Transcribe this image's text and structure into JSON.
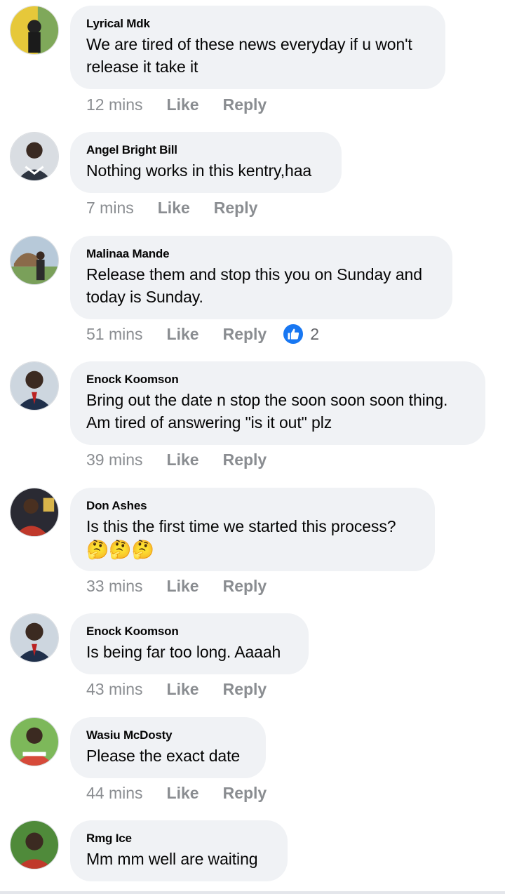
{
  "comments": [
    {
      "author": "Lyrical Mdk",
      "text": "We are tired of these news everyday if u won't release it take it",
      "time": "12 mins",
      "like": "Like",
      "reply": "Reply"
    },
    {
      "author": "Angel Bright Bill",
      "text": "Nothing works in this kentry,haa",
      "time": "7 mins",
      "like": "Like",
      "reply": "Reply"
    },
    {
      "author": "Malinaa Mande",
      "text": "Release them and stop this you on Sunday and today is Sunday.",
      "time": "51 mins",
      "like": "Like",
      "reply": "Reply",
      "reaction_count": "2"
    },
    {
      "author": "Enock Koomson",
      "text": "Bring out the date n stop the soon soon soon thing. Am tired of answering \"is it out\" plz",
      "time": "39 mins",
      "like": "Like",
      "reply": "Reply"
    },
    {
      "author": "Don Ashes",
      "text": "Is this the first time we started this process?",
      "emoji": "🤔🤔🤔",
      "time": "33 mins",
      "like": "Like",
      "reply": "Reply"
    },
    {
      "author": "Enock Koomson",
      "text": "Is being far too long. Aaaah",
      "time": "43 mins",
      "like": "Like",
      "reply": "Reply"
    },
    {
      "author": "Wasiu McDosty",
      "text": "Please the exact date",
      "time": "44 mins",
      "like": "Like",
      "reply": "Reply"
    },
    {
      "author": "Rmg Ice",
      "text": "Mm mm well are waiting"
    }
  ],
  "colors": {
    "bubble": "#f0f2f5",
    "meta": "#8a8d91",
    "like_badge": "#1877f2"
  },
  "icons": {
    "reaction": "thumbs-up-icon",
    "emoji": "thinking-face-emoji"
  }
}
